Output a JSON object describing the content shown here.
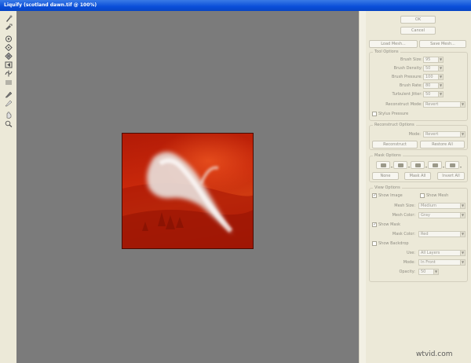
{
  "window": {
    "title": "Liquify (scotland dawn.tif @ 100%)"
  },
  "toolbox": {
    "tools": [
      {
        "icon": "forward-warp-icon"
      },
      {
        "icon": "reconstruct-icon"
      },
      {
        "icon": "twirl-clockwise-icon"
      },
      {
        "icon": "pucker-icon"
      },
      {
        "icon": "bloat-icon"
      },
      {
        "icon": "push-left-icon"
      },
      {
        "icon": "mirror-icon"
      },
      {
        "icon": "turbulence-icon"
      },
      {
        "icon": "freeze-mask-icon"
      },
      {
        "icon": "thaw-mask-icon"
      },
      {
        "icon": "hand-icon"
      },
      {
        "icon": "zoom-icon"
      }
    ]
  },
  "buttons": {
    "ok": "OK",
    "cancel": "Cancel",
    "load_mesh": "Load Mesh...",
    "save_mesh": "Save Mesh..."
  },
  "tool_options": {
    "title": "Tool Options",
    "brush_size_label": "Brush Size:",
    "brush_size": "95",
    "brush_density_label": "Brush Density:",
    "brush_density": "50",
    "brush_pressure_label": "Brush Pressure:",
    "brush_pressure": "100",
    "brush_rate_label": "Brush Rate:",
    "brush_rate": "80",
    "turbulent_jitter_label": "Turbulent Jitter:",
    "turbulent_jitter": "50",
    "reconstruct_mode_label": "Reconstruct Mode:",
    "reconstruct_mode": "Revert",
    "stylus_pressure_label": "Stylus Pressure",
    "stylus_pressure": false
  },
  "reconstruct_options": {
    "title": "Reconstruct Options",
    "mode_label": "Mode:",
    "mode": "Revert",
    "reconstruct_button": "Reconstruct",
    "restore_all_button": "Restore All"
  },
  "mask_options": {
    "title": "Mask Options",
    "none_button": "None",
    "mask_all_button": "Mask All",
    "invert_all_button": "Invert All"
  },
  "view_options": {
    "title": "View Options",
    "show_image_label": "Show Image",
    "show_image": true,
    "show_mesh_label": "Show Mesh",
    "show_mesh": false,
    "mesh_size_label": "Mesh Size:",
    "mesh_size": "Medium",
    "mesh_color_label": "Mesh Color:",
    "mesh_color": "Gray",
    "show_mask_label": "Show Mask",
    "show_mask": true,
    "mask_color_label": "Mask Color:",
    "mask_color": "Red",
    "show_backdrop_label": "Show Backdrop",
    "show_backdrop": false,
    "use_label": "Use:",
    "use": "All Layers",
    "mode_label": "Mode:",
    "mode": "In Front",
    "opacity_label": "Opacity:",
    "opacity": "50"
  },
  "watermark": "wtvid.com",
  "colors": {
    "titlebar": "#0a4ed9",
    "canvas": "#7b7b7b",
    "panel": "#ece9d8",
    "mask_red": "#c8280b"
  }
}
